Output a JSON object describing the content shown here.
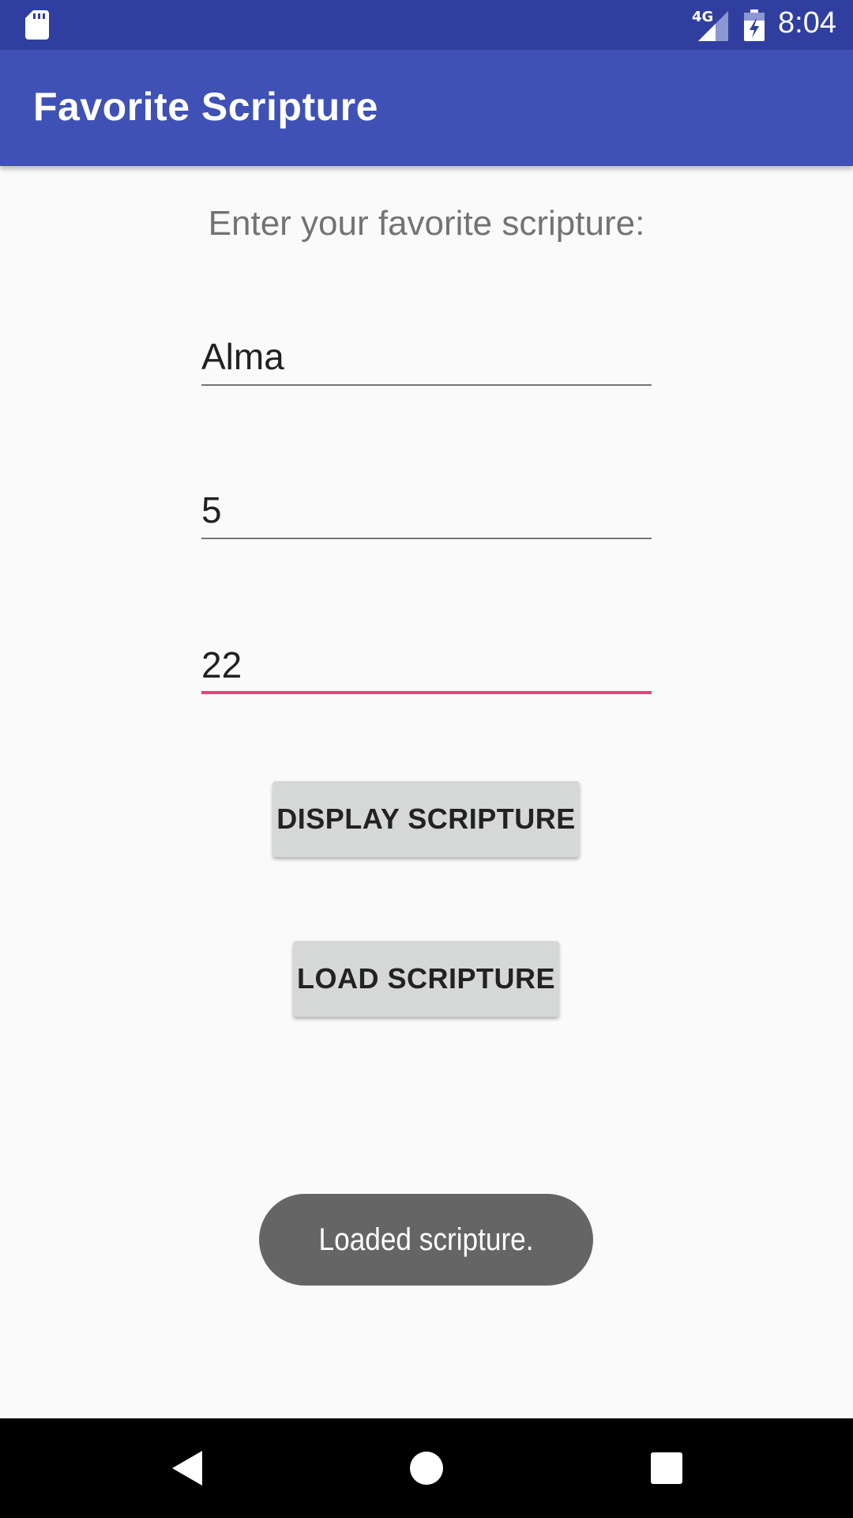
{
  "status_bar": {
    "network_label": "4G",
    "time": "8:04",
    "icons": [
      "sd-card-icon",
      "signal-icon",
      "battery-charging-icon"
    ]
  },
  "app_bar": {
    "title": "Favorite Scripture"
  },
  "main": {
    "prompt": "Enter your favorite scripture:",
    "fields": [
      {
        "name": "book",
        "value": "Alma"
      },
      {
        "name": "chapter",
        "value": "5"
      },
      {
        "name": "verse",
        "value": "22"
      }
    ],
    "display_button_label": "DISPLAY SCRIPTURE",
    "load_button_label": "LOAD SCRIPTURE"
  },
  "toast": {
    "message": "Loaded scripture."
  },
  "nav_bar": {
    "icons": [
      "back-icon",
      "home-icon",
      "recents-icon"
    ]
  },
  "colors": {
    "status_bar": "#303f9f",
    "app_bar": "#3f51b5",
    "accent": "#ec407a",
    "button": "#d6d7d7",
    "toast": "#656565"
  }
}
